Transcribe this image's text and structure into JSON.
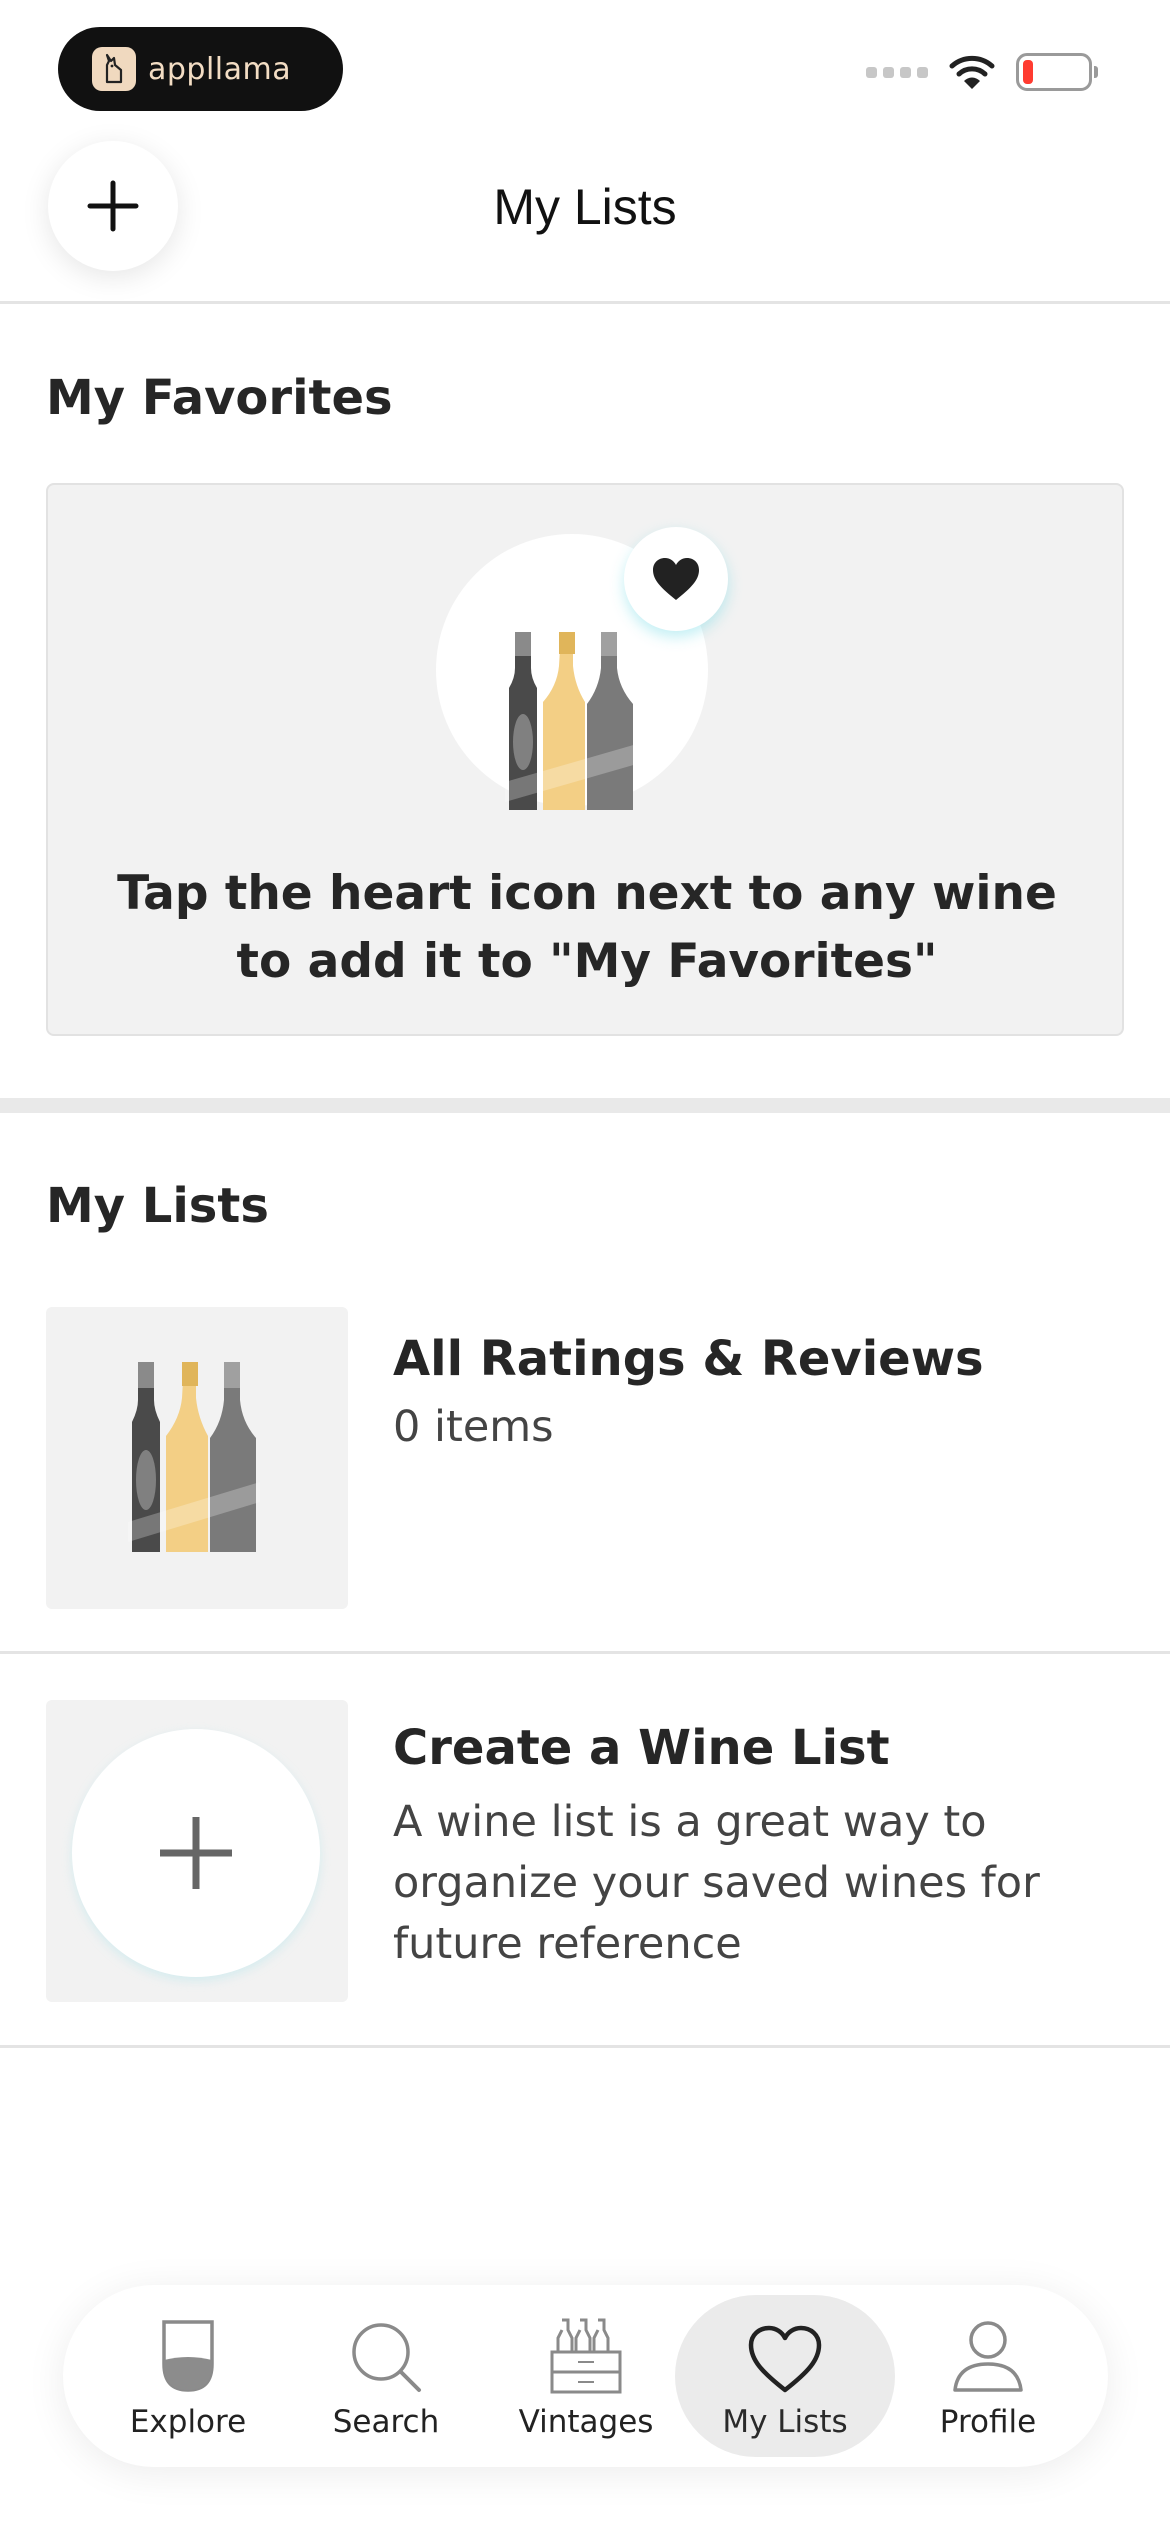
{
  "status_bar": {
    "app_name": "appllama",
    "icons": [
      "signal-icon",
      "wifi-icon",
      "battery-icon"
    ],
    "battery_color": "#ff3b30"
  },
  "header": {
    "title": "My Lists",
    "add_icon": "plus-icon"
  },
  "favorites": {
    "heading": "My Favorites",
    "message": "Tap the heart icon next to any wine to add it to \"My Favorites\"",
    "icons": [
      "wine-bottles-icon",
      "heart-icon"
    ]
  },
  "lists": {
    "heading": "My Lists",
    "items": [
      {
        "title": "All Ratings & Reviews",
        "subtitle": "0 items",
        "icon": "wine-bottles-icon"
      },
      {
        "title": "Create a Wine List",
        "subtitle": "A wine list is a great way to organize your saved wines for future reference",
        "icon": "plus-icon"
      }
    ]
  },
  "tab_bar": {
    "active": "My Lists",
    "tabs": [
      {
        "label": "Explore",
        "icon": "wine-glass-icon"
      },
      {
        "label": "Search",
        "icon": "search-icon"
      },
      {
        "label": "Vintages",
        "icon": "wine-crate-icon"
      },
      {
        "label": "My Lists",
        "icon": "heart-icon"
      },
      {
        "label": "Profile",
        "icon": "person-icon"
      }
    ]
  },
  "colors": {
    "card_background": "#f2f2f2",
    "active_tab_background": "#ebebeb",
    "bottle_gold": "#f3cf85",
    "bottle_dark": "#4a4a4a",
    "bottle_gray": "#7a7a7a"
  }
}
